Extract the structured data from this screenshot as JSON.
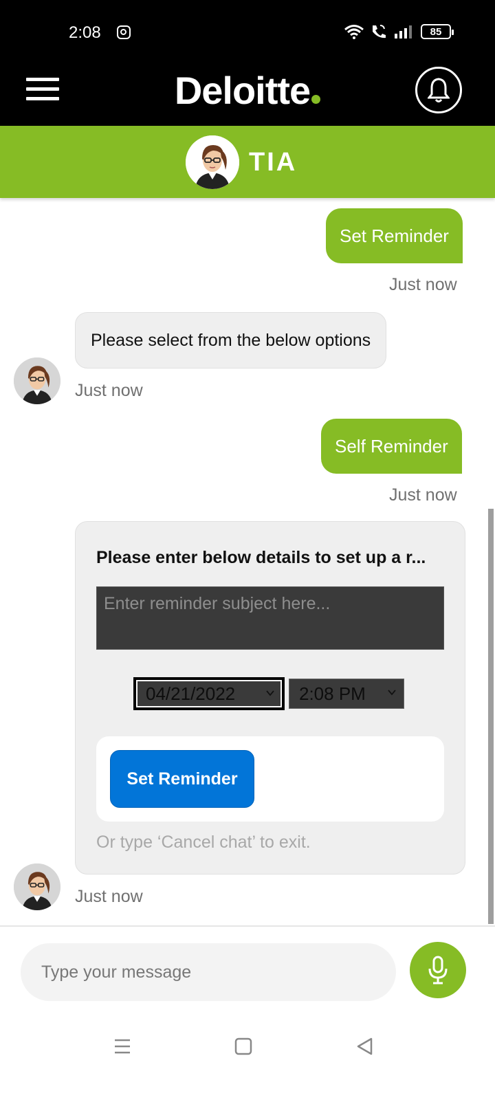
{
  "status_bar": {
    "time": "2:08",
    "battery": "85",
    "icons": [
      "instagram-icon",
      "wifi-icon",
      "wifi-call-icon",
      "signal-icon",
      "battery-icon"
    ]
  },
  "header": {
    "brand": "Deloitte",
    "brand_accent_color": "#86bc25",
    "icons": [
      "hamburger-menu-icon",
      "bell-icon"
    ]
  },
  "bot": {
    "name": "TIA",
    "bar_color": "#86bc25"
  },
  "messages": [
    {
      "from": "user",
      "text": "Set Reminder",
      "time": "Just now"
    },
    {
      "from": "bot",
      "text": "Please select from the below options",
      "time": "Just now"
    },
    {
      "from": "user",
      "text": "Self Reminder",
      "time": "Just now"
    }
  ],
  "reminder_card": {
    "title": "Please enter below details to set up a r...",
    "subject_placeholder": "Enter reminder subject here...",
    "date": "04/21/2022",
    "time": "2:08 PM",
    "button_label": "Set Reminder",
    "hint": "Or type ‘Cancel chat’ to exit.",
    "timestamp": "Just now",
    "button_color": "#0275d8"
  },
  "composer": {
    "placeholder": "Type your message",
    "mic_icon": "microphone-icon"
  },
  "nav": {
    "icons": [
      "recents-icon",
      "home-icon",
      "back-icon"
    ]
  }
}
